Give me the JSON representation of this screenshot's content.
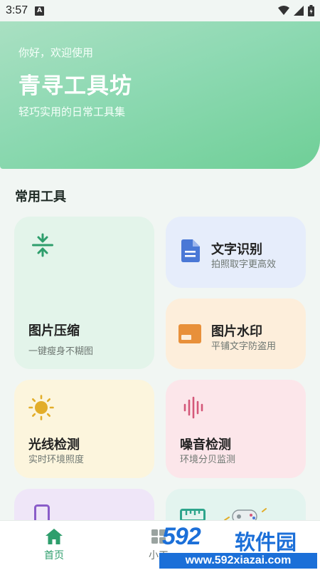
{
  "status_bar": {
    "time": "3:57",
    "notification_letter": "A"
  },
  "header": {
    "greeting": "你好，欢迎使用",
    "title": "青寻工具坊",
    "subtitle": "轻巧实用的日常工具集"
  },
  "section_title": "常用工具",
  "tools": {
    "compress": {
      "title": "图片压缩",
      "desc": "一键瘦身不糊图",
      "icon": "compress-icon",
      "bg": "#e3f4ea",
      "icon_color": "#2e9e6c"
    },
    "ocr": {
      "title": "文字识别",
      "desc": "拍照取字更高效",
      "icon": "document-icon",
      "bg": "#e6edfb",
      "icon_color": "#4a78d6"
    },
    "watermark": {
      "title": "图片水印",
      "desc": "平铺文字防盗用",
      "icon": "watermark-icon",
      "bg": "#fdeedb",
      "icon_color": "#e8903a"
    },
    "light": {
      "title": "光线检测",
      "desc": "实时环境照度",
      "icon": "sun-icon",
      "bg": "#fcf5dd",
      "icon_color": "#e2ad2a"
    },
    "noise": {
      "title": "噪音检测",
      "desc": "环境分贝监测",
      "icon": "soundwave-icon",
      "bg": "#fce6ea",
      "icon_color": "#d4587a"
    },
    "partial_left": {
      "icon": "phone-icon",
      "bg": "#efe6f8",
      "icon_color": "#8a5cc9"
    },
    "partial_right": {
      "icon": "ruler-icon",
      "bg": "#e3f4ef",
      "icon_color": "#2ea58c"
    }
  },
  "bottom_nav": {
    "home_label": "首页",
    "second_label": "小工",
    "active_color": "#2e9e6c"
  },
  "watermark_overlay": {
    "logo": "592",
    "brand": "软件园",
    "url": "www.592xiazai.com"
  }
}
